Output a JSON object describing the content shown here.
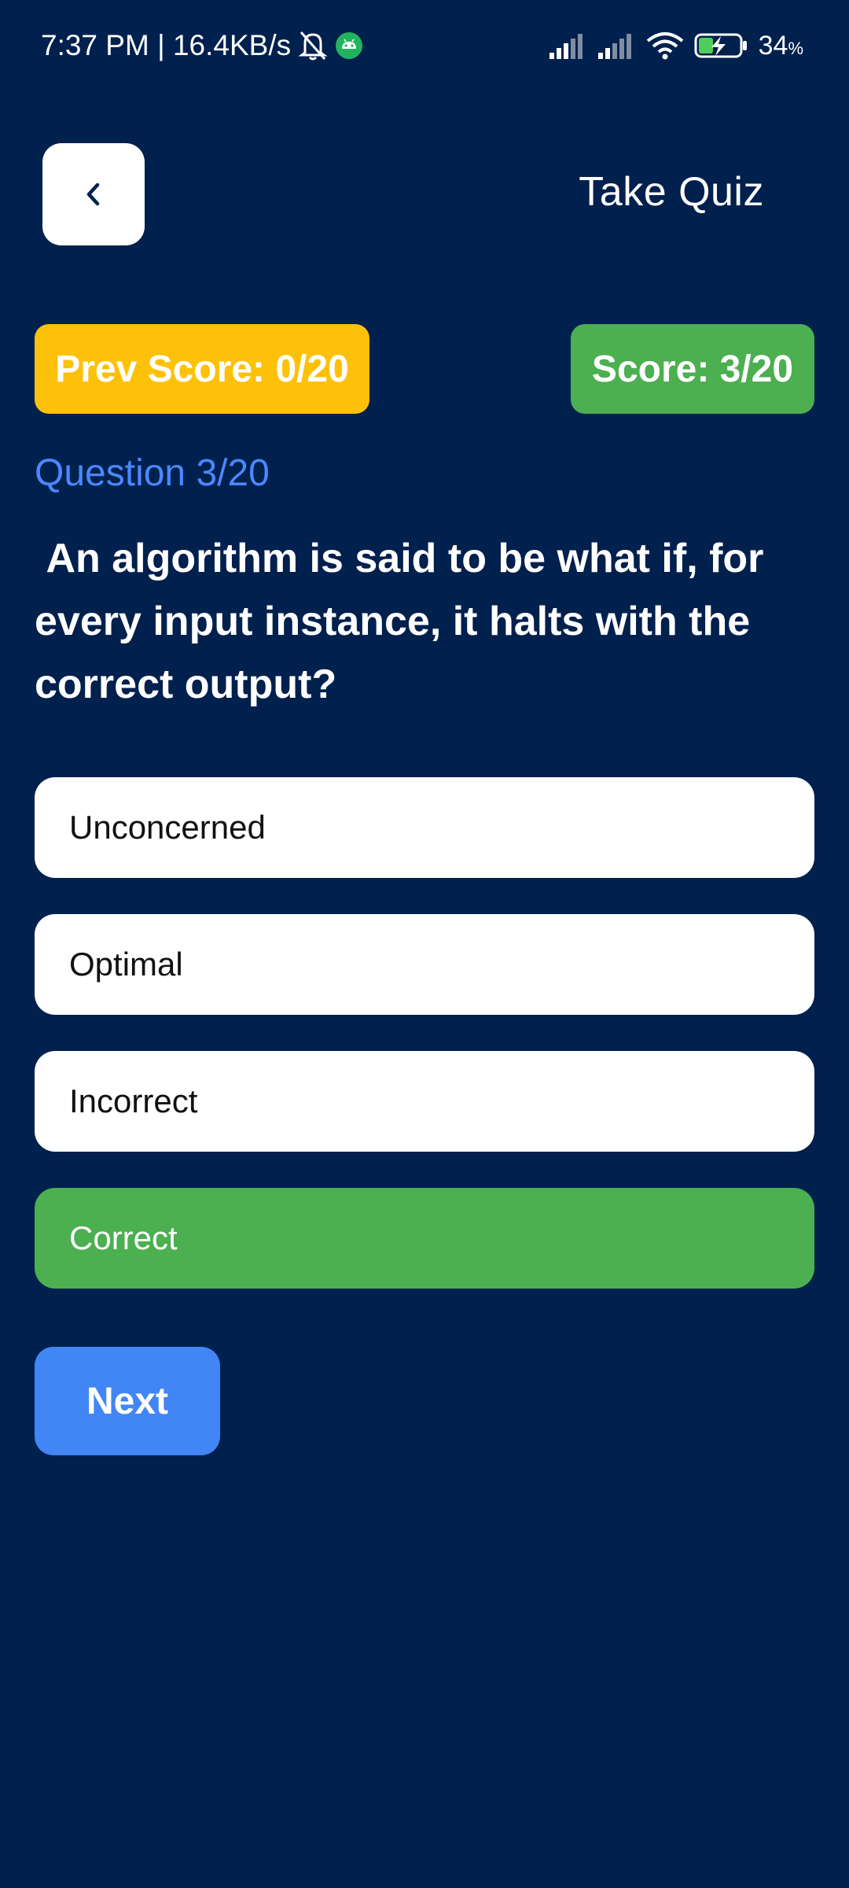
{
  "status_bar": {
    "time_speed": "7:37 PM | 16.4KB/s",
    "battery_percent": "34",
    "battery_unit": "%",
    "icons": [
      "bell-muted-icon",
      "android-icon",
      "signal-1-icon",
      "signal-2-icon",
      "wifi-icon",
      "battery-charging-icon"
    ]
  },
  "header": {
    "title": "Take Quiz",
    "back_icon": "chevron-left-icon"
  },
  "scores": {
    "previous": "Prev Score: 0/20",
    "current": "Score: 3/20"
  },
  "question": {
    "counter": "Question 3/20",
    "text": " An algorithm is said to be what if, for every input instance, it halts with the correct output?"
  },
  "options": [
    {
      "label": "Unconcerned",
      "selected": false
    },
    {
      "label": "Optimal",
      "selected": false
    },
    {
      "label": "Incorrect",
      "selected": false
    },
    {
      "label": "Correct",
      "selected": true
    }
  ],
  "actions": {
    "next_label": "Next"
  },
  "colors": {
    "background": "#00204d",
    "prev_badge": "#fec10a",
    "score_badge": "#4caf50",
    "selected_option": "#4caf50",
    "accent_blue": "#4285f4",
    "counter_blue": "#4a88ff"
  }
}
